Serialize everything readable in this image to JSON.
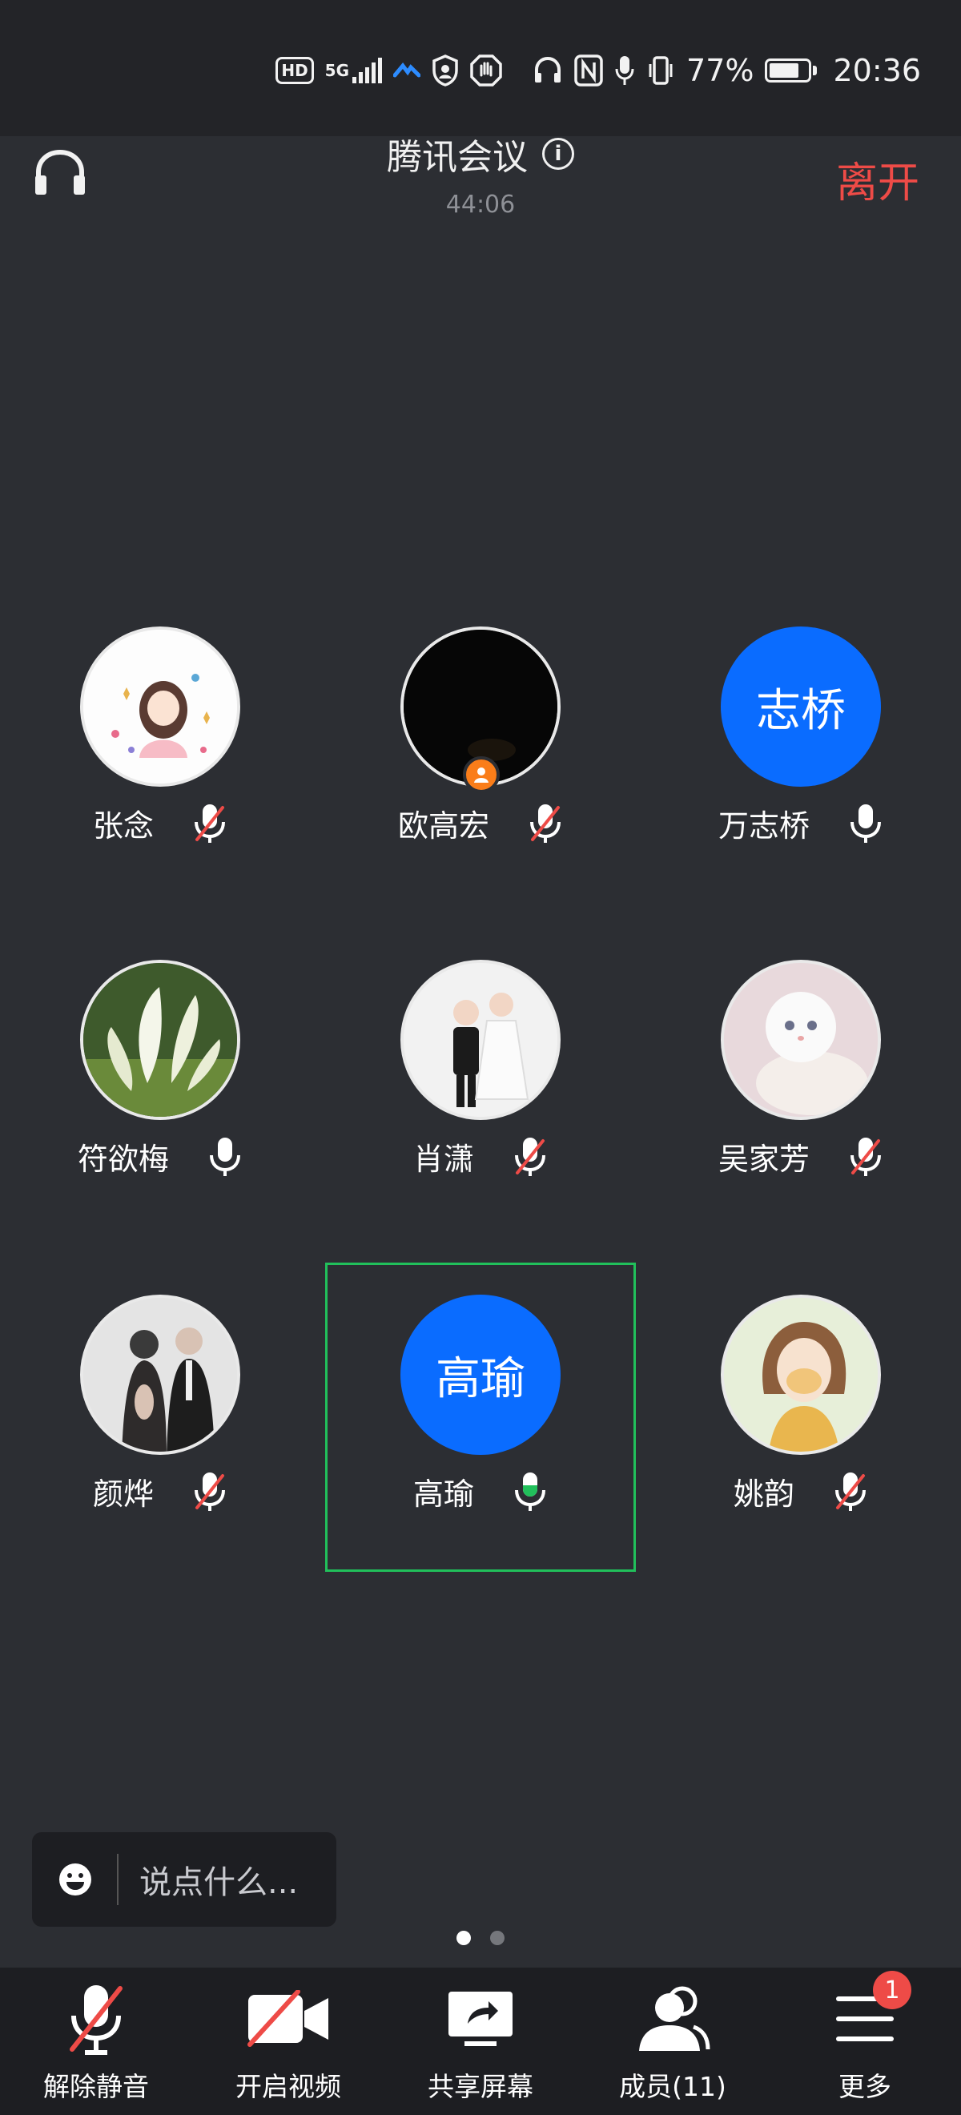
{
  "status_bar": {
    "hd_label": "HD",
    "net_label": "5G",
    "battery_percent": "77%",
    "battery_level": 0.77,
    "time": "20:36"
  },
  "header": {
    "title": "腾讯会议",
    "timer": "44:06",
    "leave_label": "离开"
  },
  "participants": [
    {
      "name": "张念",
      "avatar_kind": "illustration-girl",
      "mic": "muted"
    },
    {
      "name": "欧高宏",
      "avatar_kind": "dark-photo",
      "mic": "muted",
      "host": true
    },
    {
      "name": "万志桥",
      "avatar_text": "志桥",
      "mic": "on"
    },
    {
      "name": "符欲梅",
      "avatar_kind": "flowers-photo",
      "mic": "on"
    },
    {
      "name": "肖潇",
      "avatar_kind": "kids-photo",
      "mic": "muted"
    },
    {
      "name": "吴家芳",
      "avatar_kind": "cat-photo",
      "mic": "muted"
    },
    {
      "name": "颜烨",
      "avatar_kind": "couple-photo",
      "mic": "muted"
    },
    {
      "name": "高瑜",
      "avatar_text": "高瑜",
      "mic": "speaking",
      "active_speaker": true
    },
    {
      "name": "姚韵",
      "avatar_kind": "girl-portrait",
      "mic": "muted"
    }
  ],
  "chat": {
    "placeholder": "说点什么..."
  },
  "pager": {
    "pages": 2,
    "current": 1
  },
  "toolbar": {
    "unmute_label": "解除静音",
    "video_label": "开启视频",
    "share_label": "共享屏幕",
    "members_label": "成员(11)",
    "more_label": "更多",
    "more_badge": "1"
  },
  "colors": {
    "background": "#2c2e33",
    "accent_blue": "#0a6cff",
    "leave_red": "#ee4b47",
    "speaker_green": "#21c05b",
    "host_orange": "#fa7d19"
  }
}
